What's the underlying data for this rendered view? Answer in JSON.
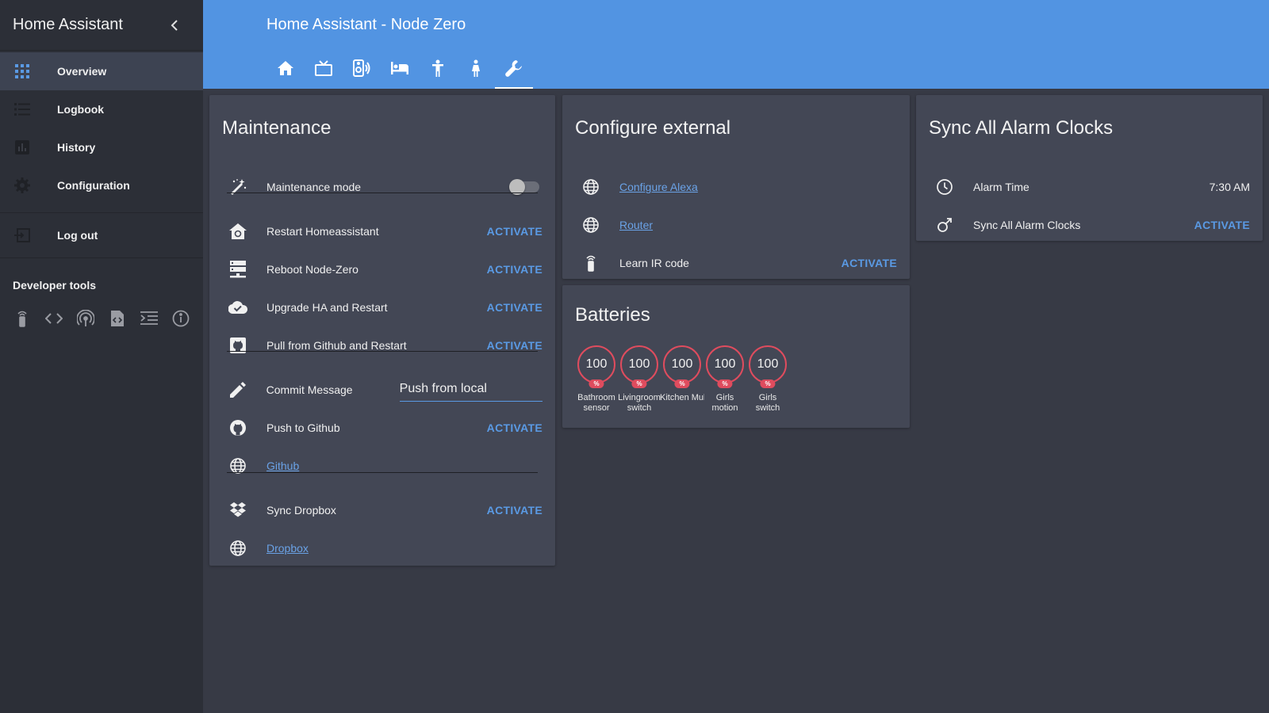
{
  "sidebar": {
    "title": "Home Assistant",
    "items": [
      {
        "label": "Overview",
        "icon": "apps-icon"
      },
      {
        "label": "Logbook",
        "icon": "list-icon"
      },
      {
        "label": "History",
        "icon": "chart-icon"
      },
      {
        "label": "Configuration",
        "icon": "gear-icon"
      },
      {
        "label": "Log out",
        "icon": "logout-icon"
      }
    ],
    "dev_tools_title": "Developer tools",
    "dev_tools_icons": [
      "remote-icon",
      "code-icon",
      "broadcast-icon",
      "file-code-icon",
      "indent-icon",
      "info-icon"
    ]
  },
  "header": {
    "title": "Home Assistant - Node Zero",
    "tabs": [
      "home-icon",
      "tv-icon",
      "speaker-icon",
      "bed-icon",
      "human-child-icon",
      "human-female-icon",
      "wrench-icon"
    ],
    "active_tab": 6
  },
  "maintenance": {
    "title": "Maintenance",
    "rows": [
      {
        "name": "Maintenance mode",
        "icon": "wand-icon",
        "toggle": false
      },
      {
        "name": "Restart Homeassistant",
        "icon": "home-restart-icon",
        "action": "ACTIVATE"
      },
      {
        "name": "Reboot Node-Zero",
        "icon": "server-icon",
        "action": "ACTIVATE"
      },
      {
        "name": "Upgrade HA and Restart",
        "icon": "cloud-check-icon",
        "action": "ACTIVATE"
      },
      {
        "name": "Pull from Github and Restart",
        "icon": "github-box-icon",
        "action": "ACTIVATE"
      },
      {
        "name": "Commit Message",
        "icon": "pencil-icon",
        "value": "Push from local"
      },
      {
        "name": "Push to Github",
        "icon": "github-icon",
        "action": "ACTIVATE"
      },
      {
        "name": "Github",
        "icon": "globe-icon",
        "link": true
      },
      {
        "name": "Sync Dropbox",
        "icon": "dropbox-icon",
        "action": "ACTIVATE"
      },
      {
        "name": "Dropbox",
        "icon": "globe-icon",
        "link": true
      }
    ]
  },
  "external": {
    "title": "Configure external",
    "rows": [
      {
        "name": "Configure Alexa",
        "icon": "globe-icon",
        "link": true
      },
      {
        "name": "Router",
        "icon": "globe-icon",
        "link": true
      },
      {
        "name": "Learn IR code",
        "icon": "remote-icon",
        "action": "ACTIVATE"
      }
    ]
  },
  "batteries": {
    "title": "Batteries",
    "items": [
      {
        "value": "100",
        "unit": "%",
        "name": "Bathroom sensor"
      },
      {
        "value": "100",
        "unit": "%",
        "name": "Livingroom switch"
      },
      {
        "value": "100",
        "unit": "%",
        "name": "Kitchen Multisens..."
      },
      {
        "value": "100",
        "unit": "%",
        "name": "Girls motion"
      },
      {
        "value": "100",
        "unit": "%",
        "name": "Girls switch"
      }
    ]
  },
  "alarm": {
    "title": "Sync All Alarm Clocks",
    "rows": [
      {
        "name": "Alarm Time",
        "icon": "clock-icon",
        "value": "7:30 AM"
      },
      {
        "name": "Sync All Alarm Clocks",
        "icon": "gender-male-icon",
        "action": "ACTIVATE"
      }
    ]
  },
  "colors": {
    "accent": "#5294e2",
    "background": "#373a45",
    "card": "#434755",
    "sidebar": "#2c2f37",
    "battery_ring": "#df4c5e"
  }
}
